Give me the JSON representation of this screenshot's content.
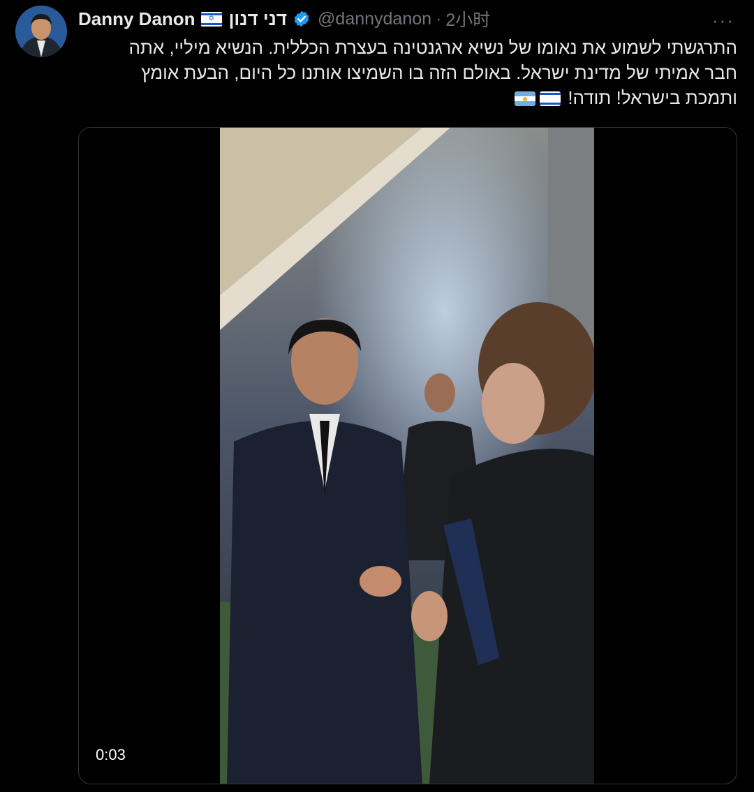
{
  "author": {
    "display_name": "Danny Danon",
    "hebrew_name": "דני דנון",
    "handle": "@dannydanon",
    "separator": "·",
    "time_ago": "2小时"
  },
  "menu": {
    "more_label": "···"
  },
  "tweet": {
    "lines": [
      "התרגשתי לשמוע את נאומו של נשיא ארגנטינה בעצרת הכללית. הנשיא מיליי, אתה",
      "חבר אמיתי של מדינת ישראל. באולם הזה בו השמיצו אותנו כל היום, הבעת אומץ",
      "ותמכת בישראל! תודה!"
    ]
  },
  "video": {
    "timestamp": "0:03"
  },
  "icons": {
    "verified": "verified-badge-icon",
    "flag_israel": "israel-flag-icon",
    "flag_argentina": "argentina-flag-icon",
    "more": "more-options-icon"
  },
  "colors": {
    "background": "#000000",
    "text": "#e7e9ea",
    "muted": "#71767b",
    "verified": "#1d9bf0",
    "border": "#333639"
  }
}
